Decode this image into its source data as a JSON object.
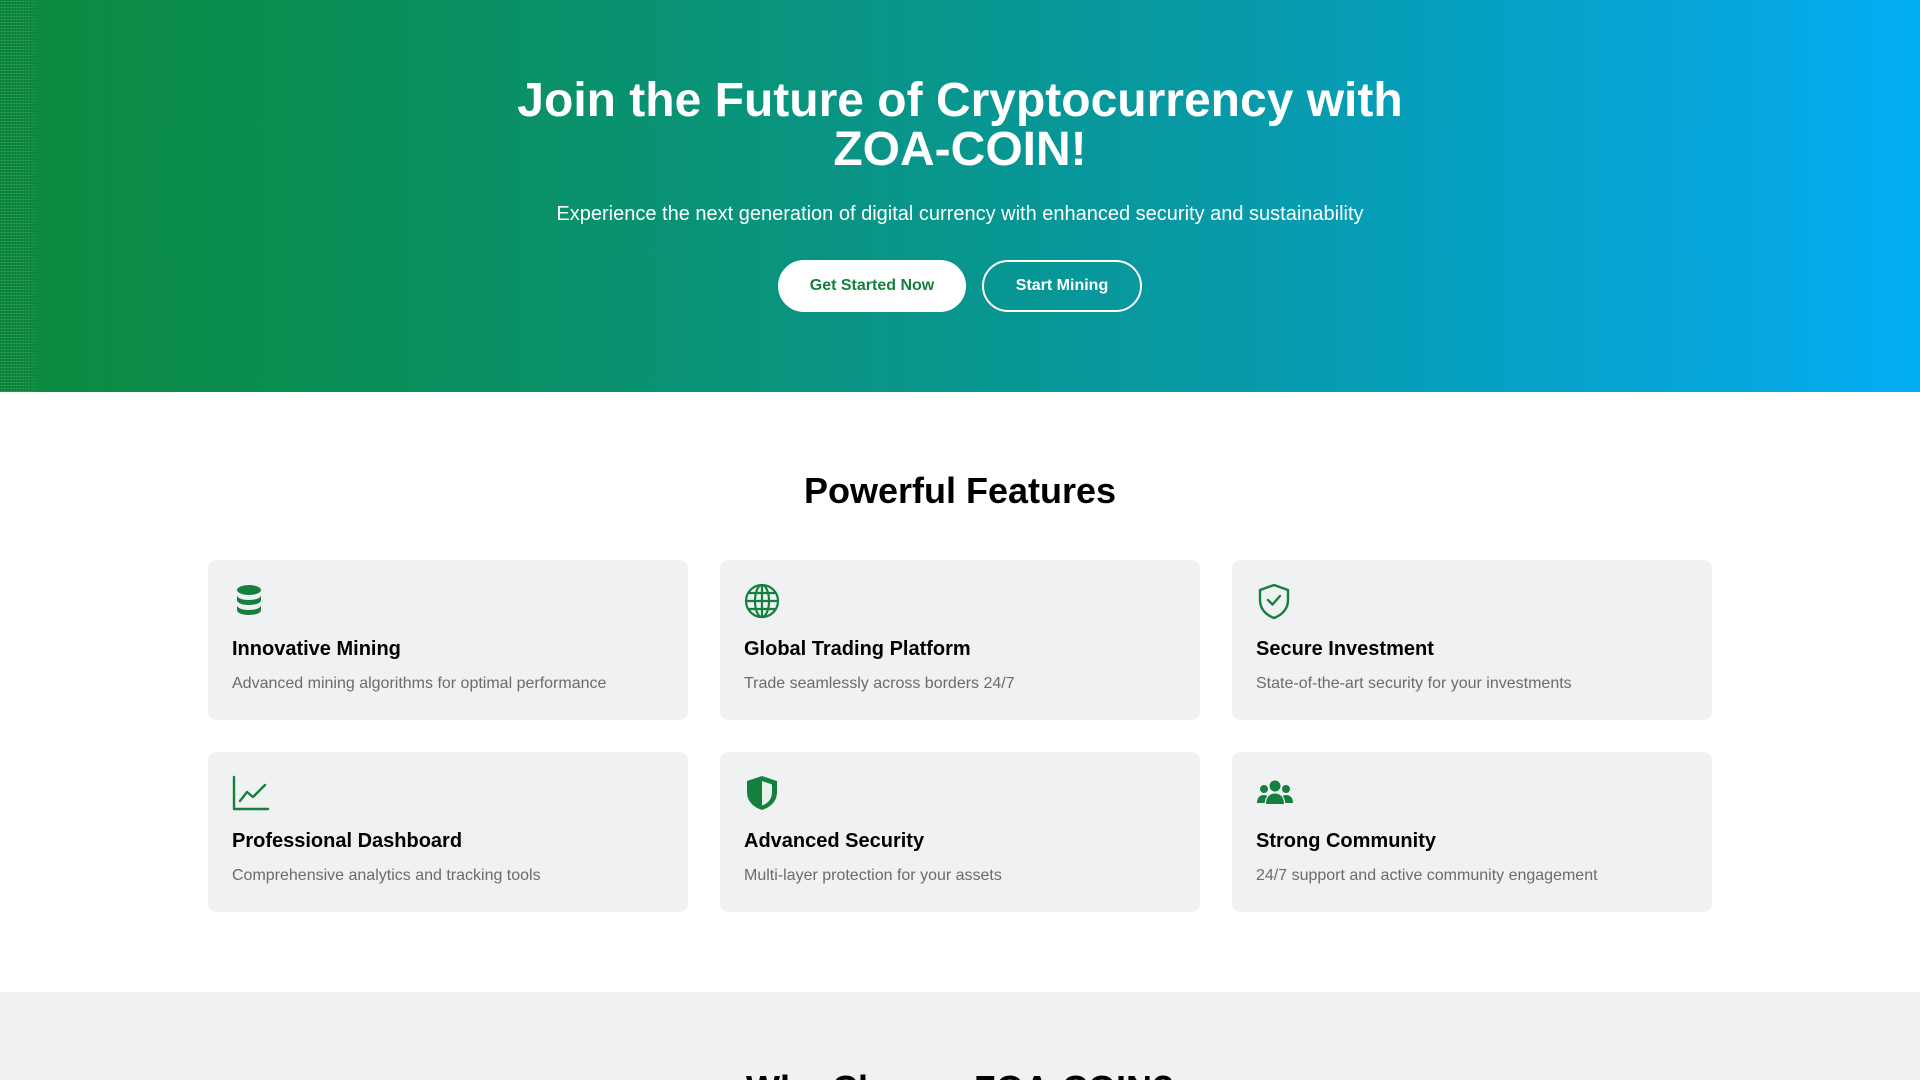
{
  "hero": {
    "title": "Join the Future of Cryptocurrency with ZOA-COIN!",
    "subtitle": "Experience the next generation of digital currency with enhanced security and sustainability",
    "primary_button": "Get Started Now",
    "secondary_button": "Start Mining"
  },
  "features": {
    "heading": "Powerful Features",
    "items": [
      {
        "icon": "database-coins-icon",
        "title": "Innovative Mining",
        "description": "Advanced mining algorithms for optimal performance"
      },
      {
        "icon": "globe-icon",
        "title": "Global Trading Platform",
        "description": "Trade seamlessly across borders 24/7"
      },
      {
        "icon": "shield-check-icon",
        "title": "Secure Investment",
        "description": "State-of-the-art security for your investments"
      },
      {
        "icon": "line-chart-icon",
        "title": "Professional Dashboard",
        "description": "Comprehensive analytics and tracking tools"
      },
      {
        "icon": "shield-half-icon",
        "title": "Advanced Security",
        "description": "Multi-layer protection for your assets"
      },
      {
        "icon": "users-icon",
        "title": "Strong Community",
        "description": "24/7 support and active community engagement"
      }
    ]
  },
  "why": {
    "heading": "Why Choose ZOA-COIN?"
  },
  "colors": {
    "brand_green": "#15803d",
    "hero_gradient_start": "#0b8a3c",
    "hero_gradient_end": "#03aef5",
    "card_background": "#f0f1f3"
  }
}
